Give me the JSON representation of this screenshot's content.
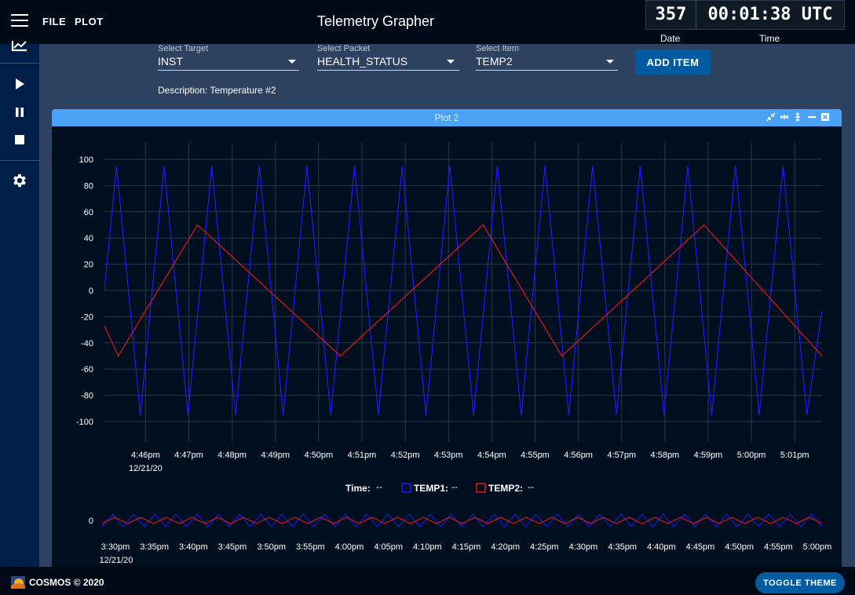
{
  "header": {
    "menu": [
      "FILE",
      "PLOT"
    ],
    "title": "Telemetry Grapher",
    "clock_day": "357",
    "clock_time": "00:01:38 UTC",
    "date_label": "Date",
    "time_label": "Time"
  },
  "selectors": {
    "target": {
      "label": "Select Target",
      "value": "INST"
    },
    "packet": {
      "label": "Select Packet",
      "value": "HEALTH_STATUS"
    },
    "item": {
      "label": "Select Item",
      "value": "TEMP2"
    },
    "add_label": "ADD ITEM"
  },
  "description": "Description: Temperature #2",
  "plot": {
    "title": "Plot 2",
    "legend": {
      "time_label": "Time:",
      "time_value": "--",
      "series1_label": "TEMP1:",
      "series1_value": "--",
      "series2_label": "TEMP2:",
      "series2_value": "--"
    }
  },
  "colors": {
    "temp1": "#1a1aff",
    "temp2": "#e01818",
    "accent": "#005ba0",
    "header": "#4aa3f5"
  },
  "sidebar_icons": [
    "chart-icon",
    "play-icon",
    "pause-icon",
    "stop-icon",
    "settings-icon"
  ],
  "chart_data": [
    {
      "type": "line",
      "x_ticks": [
        "4:46pm",
        "4:47pm",
        "4:48pm",
        "4:49pm",
        "4:50pm",
        "4:51pm",
        "4:52pm",
        "4:53pm",
        "4:54pm",
        "4:55pm",
        "4:56pm",
        "4:57pm",
        "4:58pm",
        "4:59pm",
        "5:00pm",
        "5:01pm"
      ],
      "x_date": "12/21/20",
      "ylim": [
        -100,
        100
      ],
      "y_ticks": [
        100,
        80,
        60,
        40,
        20,
        0,
        -20,
        -40,
        -60,
        -80,
        -100
      ],
      "grid": true,
      "x_range_minutes": [
        45.05,
        61.63
      ],
      "series": [
        {
          "name": "TEMP1",
          "x_minutes": [
            45.05,
            45.33,
            45.88,
            46.43,
            46.98,
            47.53,
            48.08,
            48.63,
            49.18,
            49.73,
            50.28,
            50.83,
            51.38,
            51.93,
            52.48,
            53.03,
            53.58,
            54.13,
            54.68,
            55.23,
            55.78,
            56.33,
            56.88,
            57.43,
            57.98,
            58.53,
            59.08,
            59.63,
            60.18,
            60.73,
            61.28,
            61.63
          ],
          "values": [
            0,
            95,
            -95,
            95,
            -95,
            95,
            -95,
            95,
            -95,
            95,
            -95,
            95,
            -95,
            95,
            -95,
            95,
            -95,
            95,
            -95,
            95,
            -95,
            95,
            -95,
            95,
            -95,
            95,
            -95,
            95,
            -95,
            95,
            -95,
            -15
          ]
        },
        {
          "name": "TEMP2",
          "x_minutes": [
            45.05,
            45.37,
            47.2,
            50.5,
            53.8,
            55.62,
            58.9,
            62.2
          ],
          "values": [
            -27,
            -50,
            50,
            -50,
            50,
            -50,
            50,
            -50
          ]
        }
      ]
    },
    {
      "type": "line",
      "x_ticks": [
        "3:30pm",
        "3:35pm",
        "3:40pm",
        "3:45pm",
        "3:50pm",
        "3:55pm",
        "4:00pm",
        "4:05pm",
        "4:10pm",
        "4:15pm",
        "4:20pm",
        "4:25pm",
        "4:30pm",
        "4:35pm",
        "4:40pm",
        "4:45pm",
        "4:50pm",
        "4:55pm",
        "5:00pm"
      ],
      "x_date": "12/21/20",
      "y_ticks": [
        0
      ],
      "note": "overview strip"
    }
  ]
}
